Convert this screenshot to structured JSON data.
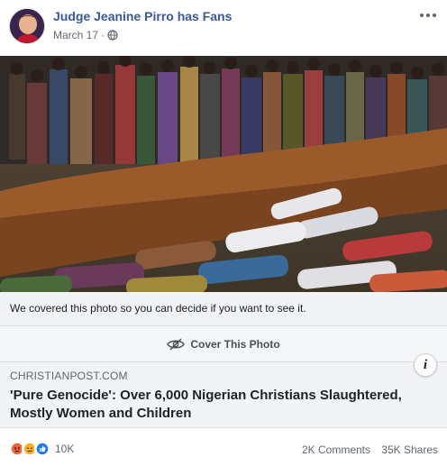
{
  "post": {
    "page_name": "Judge Jeanine Pirro has Fans",
    "date": "March 17",
    "separator": "·",
    "privacy_icon": "globe-icon",
    "more_icon": "more-options-icon"
  },
  "photo": {
    "icon": "covered-graphic-photo"
  },
  "warning": {
    "text": "We covered this photo so you can decide if you want to see it."
  },
  "cover_button": {
    "label": "Cover This Photo",
    "icon": "eye-slash-icon"
  },
  "link_preview": {
    "domain": "CHRISTIANPOST.COM",
    "title": "'Pure Genocide': Over 6,000 Nigerian Christians Slaughtered, Mostly Women and Children",
    "info_label": "i"
  },
  "footer": {
    "reaction_icons": [
      "angry",
      "sad",
      "like"
    ],
    "reaction_count": "10K",
    "comments": "2K Comments",
    "shares": "35K Shares"
  },
  "colors": {
    "page_link": "#385898",
    "secondary_text": "#606770",
    "like_blue": "#1877f2",
    "angry_orange": "#f0663a",
    "sad_yellow": "#f7b125"
  }
}
